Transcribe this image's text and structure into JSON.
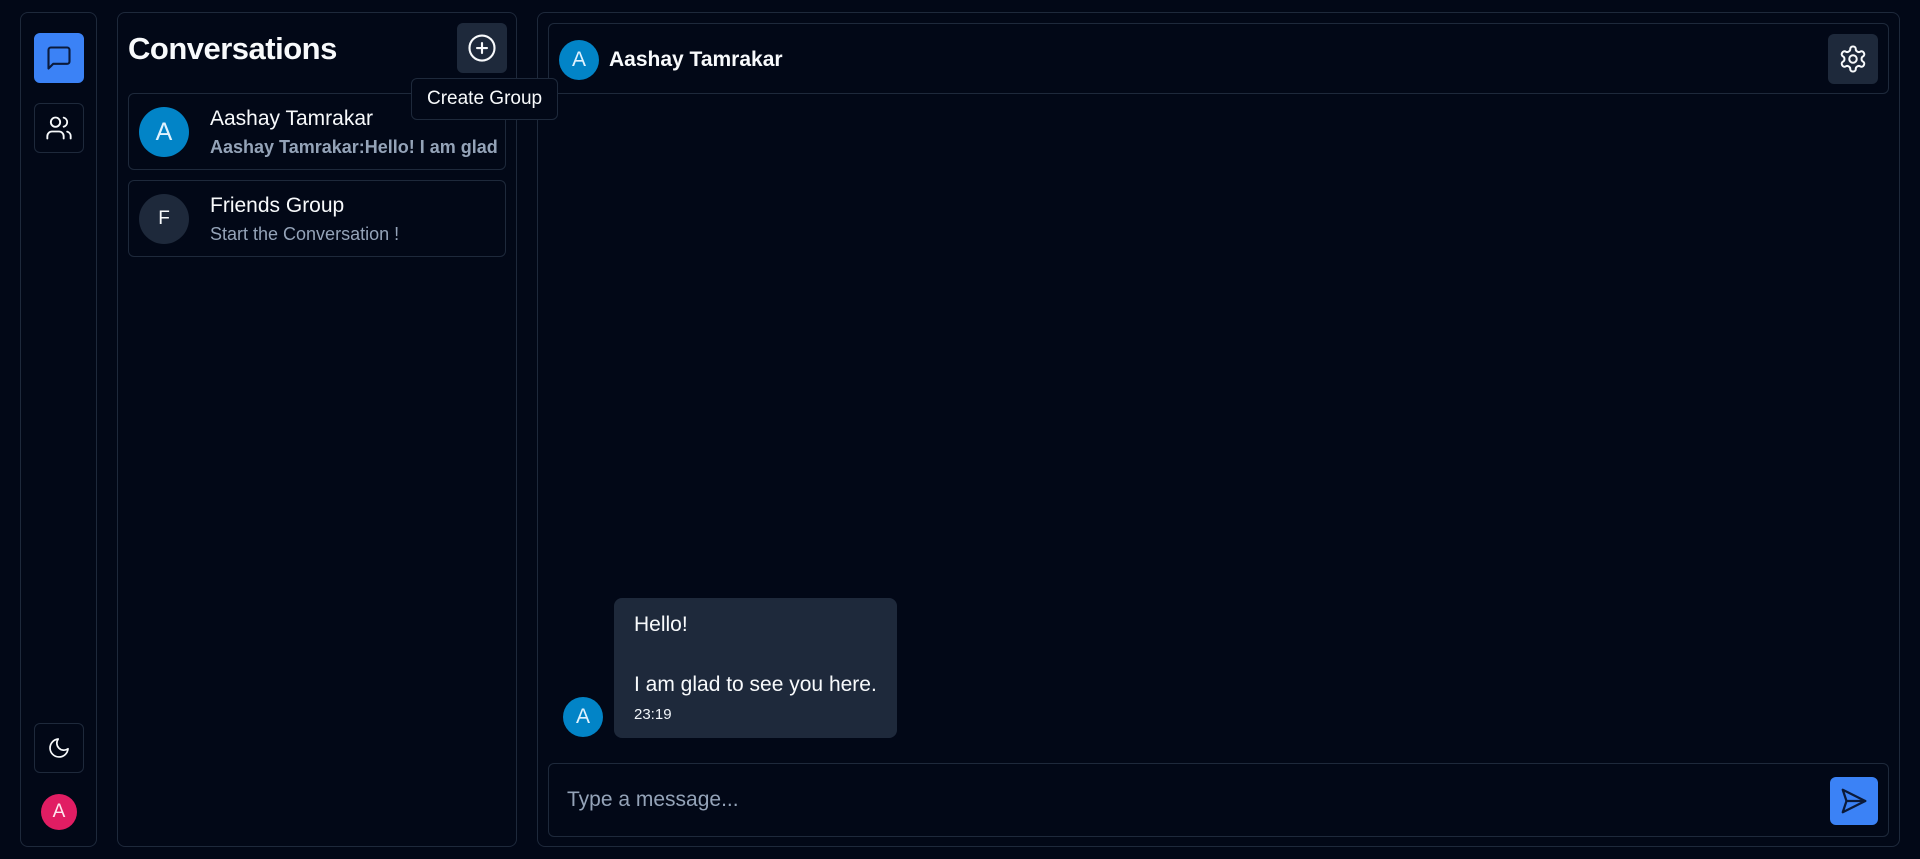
{
  "colors": {
    "background": "#020817",
    "border": "#1e293b",
    "accent": "#3b82f6",
    "avatar_blue": "#0284c7",
    "avatar_pink": "#e11d63",
    "muted_text": "#94a3b8"
  },
  "rail": {
    "items": [
      {
        "icon": "chat-bubble-icon",
        "active": true
      },
      {
        "icon": "users-icon",
        "active": false
      }
    ],
    "theme_icon": "moon-icon",
    "user_initial": "A"
  },
  "conversations": {
    "title": "Conversations",
    "add_icon": "plus-circle-icon",
    "tooltip": "Create Group",
    "items": [
      {
        "initial": "A",
        "name": "Aashay Tamrakar",
        "preview": "Aashay Tamrakar:Hello! I am glad to see you here."
      },
      {
        "initial": "F",
        "name": "Friends Group",
        "preview": "Start the Conversation !"
      }
    ]
  },
  "chat": {
    "header": {
      "initial": "A",
      "name": "Aashay Tamrakar",
      "settings_icon": "gear-icon"
    },
    "messages": [
      {
        "initial": "A",
        "line1": "Hello!",
        "line2": "I am glad to see you here.",
        "time": "23:19"
      }
    ],
    "composer": {
      "placeholder": "Type a message...",
      "value": "",
      "send_icon": "send-icon"
    }
  }
}
